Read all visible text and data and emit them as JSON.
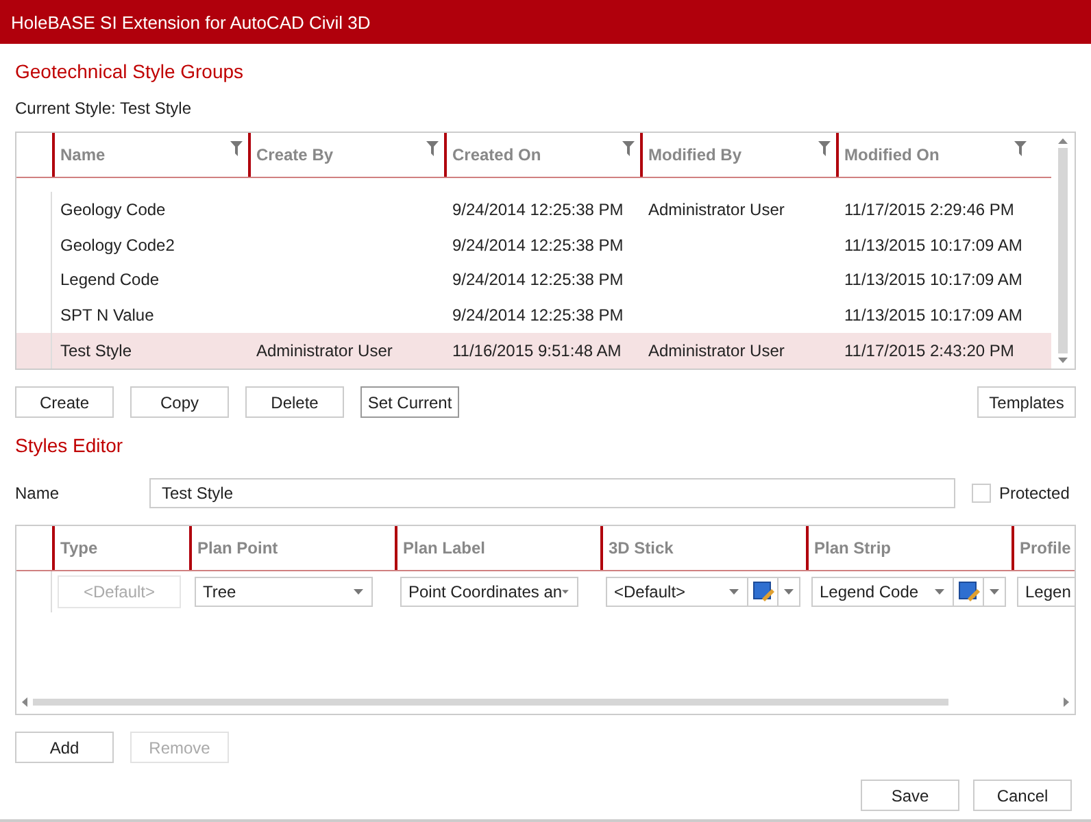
{
  "window": {
    "title": "HoleBASE SI Extension for AutoCAD Civil 3D"
  },
  "groups": {
    "heading": "Geotechnical Style Groups",
    "current_style": "Current Style: Test Style",
    "columns": [
      "Name",
      "Create By",
      "Created On",
      "Modified By",
      "Modified On"
    ],
    "rows": [
      {
        "cells": [
          "Geology Code",
          "",
          "9/24/2014 12:25:38 PM",
          "Administrator User",
          "11/17/2015 2:29:46 PM"
        ],
        "selected": false
      },
      {
        "cells": [
          "Geology Code2",
          "",
          "9/24/2014 12:25:38 PM",
          "",
          "11/13/2015 10:17:09 AM"
        ],
        "selected": false
      },
      {
        "cells": [
          "Legend Code",
          "",
          "9/24/2014 12:25:38 PM",
          "",
          "11/13/2015 10:17:09 AM"
        ],
        "selected": false
      },
      {
        "cells": [
          "SPT N Value",
          "",
          "9/24/2014 12:25:38 PM",
          "",
          "11/13/2015 10:17:09 AM"
        ],
        "selected": false
      },
      {
        "cells": [
          "Test Style",
          "Administrator User",
          "11/16/2015 9:51:48 AM",
          "Administrator User",
          "11/17/2015 2:43:20 PM"
        ],
        "selected": true
      }
    ],
    "buttons": [
      {
        "label": "Create",
        "disabled": false
      },
      {
        "label": "Copy",
        "disabled": false
      },
      {
        "label": "Delete",
        "disabled": false
      },
      {
        "label": "Set Current",
        "disabled": false
      }
    ],
    "templates_button": "Templates"
  },
  "editor": {
    "heading": "Styles Editor",
    "name_label": "Name",
    "name_value": "Test Style",
    "protected": {
      "label": "Protected",
      "checked": false
    },
    "columns": [
      "Type",
      "Plan Point",
      "Plan Label",
      "3D Stick",
      "Plan Strip",
      "Profile"
    ],
    "cells": [
      {
        "kind": "placeholder",
        "placeholder": "<Default>"
      },
      {
        "kind": "combo",
        "value": "Tree"
      },
      {
        "kind": "combo",
        "value": "Point Coordinates an"
      },
      {
        "kind": "combo-edit",
        "value": "<Default>"
      },
      {
        "kind": "combo-edit",
        "value": "Legend Code"
      },
      {
        "kind": "text",
        "value": "Legen"
      }
    ],
    "buttons": [
      {
        "label": "Add",
        "disabled": false
      },
      {
        "label": "Remove",
        "disabled": true
      }
    ]
  },
  "footer": {
    "buttons": [
      "Save",
      "Cancel"
    ]
  }
}
